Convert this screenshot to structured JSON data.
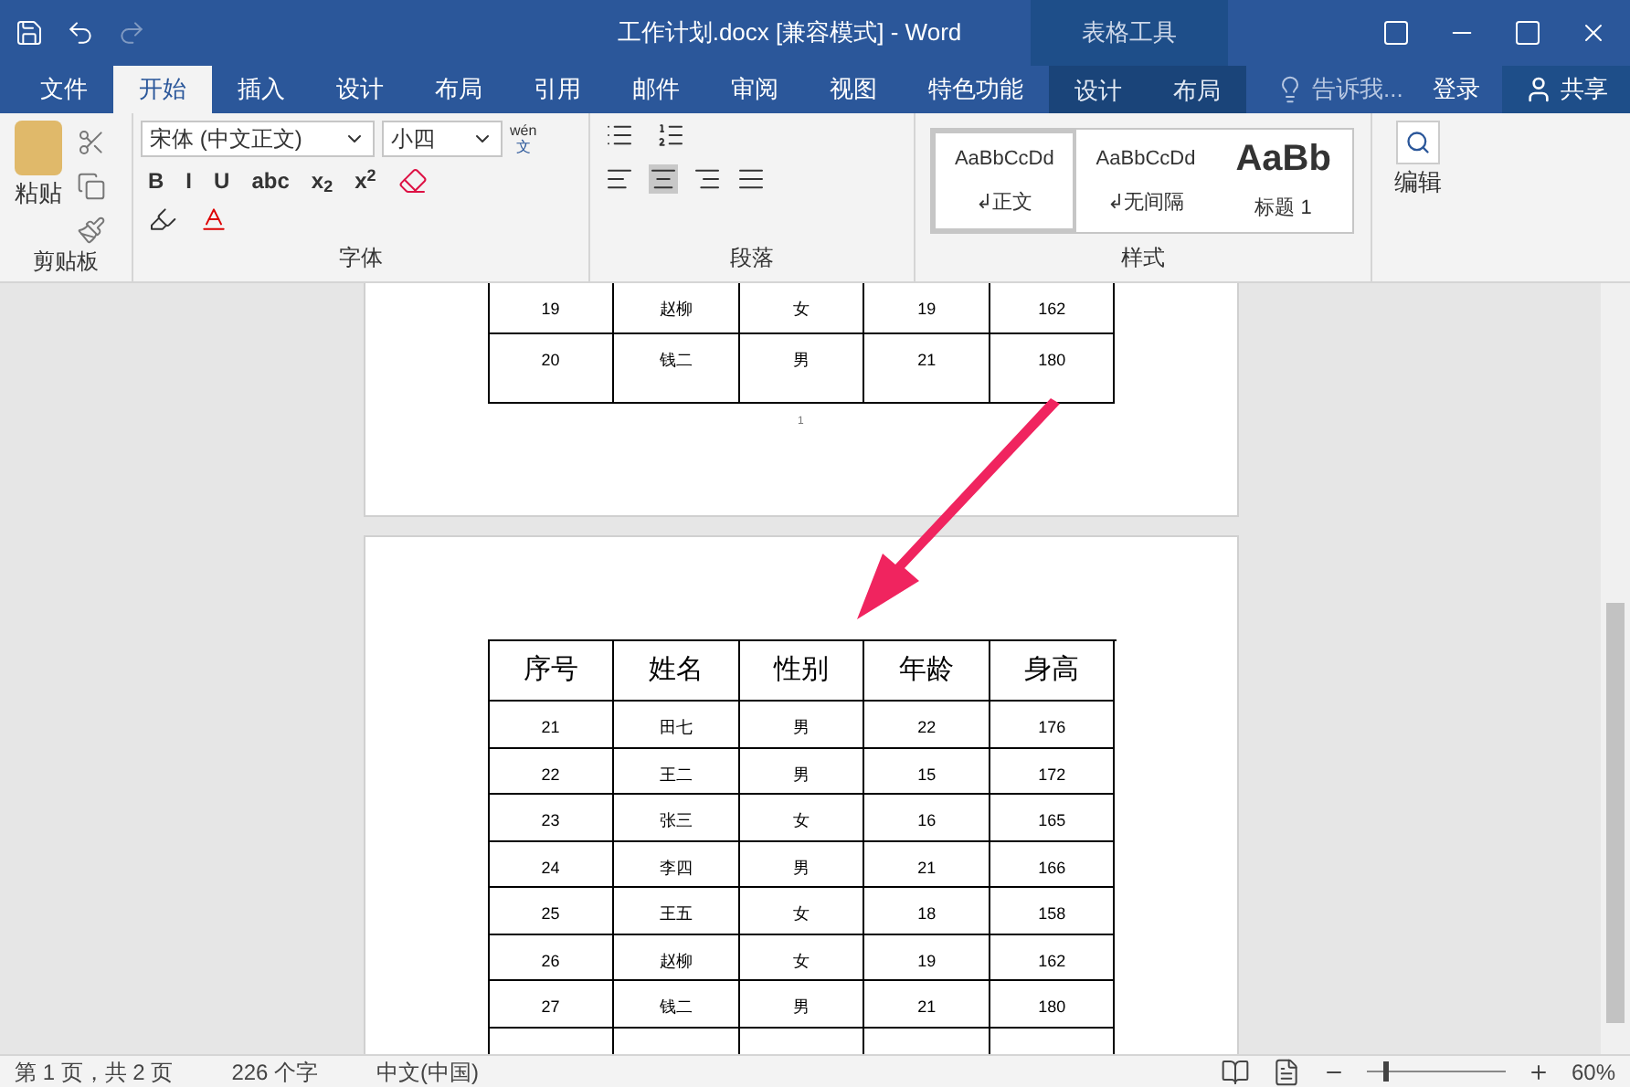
{
  "window": {
    "title": "工作计划.docx [兼容模式] - Word",
    "context_title": "表格工具"
  },
  "tabs": [
    {
      "label": "文件",
      "selected": false,
      "context": false
    },
    {
      "label": "开始",
      "selected": true,
      "context": false
    },
    {
      "label": "插入",
      "selected": false,
      "context": false
    },
    {
      "label": "设计",
      "selected": false,
      "context": false
    },
    {
      "label": "布局",
      "selected": false,
      "context": false
    },
    {
      "label": "引用",
      "selected": false,
      "context": false
    },
    {
      "label": "邮件",
      "selected": false,
      "context": false
    },
    {
      "label": "审阅",
      "selected": false,
      "context": false
    },
    {
      "label": "视图",
      "selected": false,
      "context": false
    },
    {
      "label": "特色功能",
      "selected": false,
      "context": false
    },
    {
      "label": "设计",
      "selected": false,
      "context": true
    },
    {
      "label": "布局",
      "selected": false,
      "context": true
    }
  ],
  "tell_me": "告诉我...",
  "sign_in": "登录",
  "share": "共享",
  "ribbon": {
    "clipboard": {
      "paste": "粘贴",
      "group": "剪贴板"
    },
    "font": {
      "name": "宋体 (中文正文)",
      "size": "小四",
      "buttons": [
        "B",
        "I",
        "U",
        "abc",
        "x$_{2}$",
        "x$^{2}$"
      ],
      "group": "字体",
      "wen": "wén",
      "wen2": "文"
    },
    "paragraph": {
      "group": "段落"
    },
    "styles": {
      "group": "样式",
      "items": [
        {
          "sample": "AaBbCcDd",
          "label": "↲正文",
          "selected": true,
          "kind": "normal"
        },
        {
          "sample": "AaBbCcDd",
          "label": "↲无间隔",
          "selected": false,
          "kind": "normal"
        },
        {
          "sample": "AaBb",
          "label": "标题 1",
          "selected": false,
          "kind": "heading"
        }
      ]
    },
    "editing": {
      "label": "编辑"
    }
  },
  "page1": {
    "rows": [
      [
        "19",
        "赵柳",
        "女",
        "19",
        "162"
      ],
      [
        "20",
        "钱二",
        "男",
        "21",
        "180"
      ]
    ],
    "page_number": "1"
  },
  "page2": {
    "header": [
      "序号",
      "姓名",
      "性别",
      "年龄",
      "身高"
    ],
    "rows": [
      [
        "21",
        "田七",
        "男",
        "22",
        "176"
      ],
      [
        "22",
        "王二",
        "男",
        "15",
        "172"
      ],
      [
        "23",
        "张三",
        "女",
        "16",
        "165"
      ],
      [
        "24",
        "李四",
        "男",
        "21",
        "166"
      ],
      [
        "25",
        "王五",
        "女",
        "18",
        "158"
      ],
      [
        "26",
        "赵柳",
        "女",
        "19",
        "162"
      ],
      [
        "27",
        "钱二",
        "男",
        "21",
        "180"
      ]
    ]
  },
  "status_bar": {
    "page": "第 1 页，共 2 页",
    "words": "226 个字",
    "language": "中文(中国)",
    "zoom": "60%",
    "zoom_level": {
      "level": 0.12
    }
  }
}
